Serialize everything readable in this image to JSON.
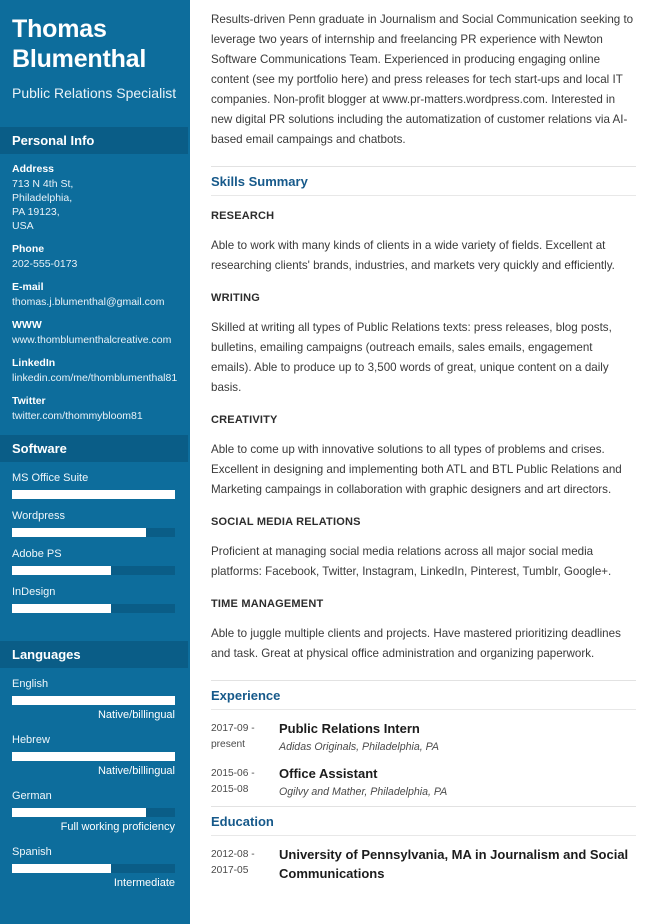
{
  "sidebar": {
    "name": "Thomas Blumenthal",
    "job_title": "Public Relations Specialist",
    "accent_color": "#0d6d9c",
    "header_band_color": "#0a5d87",
    "personal_info": {
      "heading": "Personal Info",
      "items": [
        {
          "label": "Address",
          "value": "713 N 4th St,\nPhiladelphia,\nPA 19123,\nUSA"
        },
        {
          "label": "Phone",
          "value": "202-555-0173"
        },
        {
          "label": "E-mail",
          "value": "thomas.j.blumenthal@gmail.com"
        },
        {
          "label": "WWW",
          "value": "www.thomblumenthalcreative.com"
        },
        {
          "label": "LinkedIn",
          "value": "linkedin.com/me/thomblumenthal81"
        },
        {
          "label": "Twitter",
          "value": "twitter.com/thommybloom81"
        }
      ]
    },
    "software": {
      "heading": "Software",
      "items": [
        {
          "label": "MS Office Suite",
          "percent": 100
        },
        {
          "label": "Wordpress",
          "percent": 82
        },
        {
          "label": "Adobe PS",
          "percent": 61
        },
        {
          "label": "InDesign",
          "percent": 61
        }
      ]
    },
    "languages": {
      "heading": "Languages",
      "items": [
        {
          "label": "English",
          "percent": 100,
          "level": "Native/billingual"
        },
        {
          "label": "Hebrew",
          "percent": 100,
          "level": "Native/billingual"
        },
        {
          "label": "German",
          "percent": 82,
          "level": "Full working proficiency"
        },
        {
          "label": "Spanish",
          "percent": 61,
          "level": "Intermediate"
        }
      ]
    }
  },
  "main": {
    "summary": "Results-driven Penn graduate in Journalism and Social Communication seeking to leverage two years of internship and freelancing PR experience with Newton Software Communications Team. Experienced in producing engaging online content (see my portfolio here) and press releases for tech start-ups and local IT companies. Non-profit blogger at www.pr-matters.wordpress.com. Interested in new digital PR solutions including the automatization of customer relations via AI-based email campaings and chatbots.",
    "skills_summary": {
      "heading": "Skills Summary",
      "skills": [
        {
          "name": "RESEARCH",
          "description": "Able to work with many kinds of clients in a wide variety of fields. Excellent at researching clients' brands, industries, and markets very quickly and efficiently."
        },
        {
          "name": "WRITING",
          "description": "Skilled at writing all types of Public Relations texts: press releases, blog posts, bulletins, emailing campaigns (outreach emails, sales emails, engagement emails). Able to produce up to 3,500 words of great, unique content on a daily basis."
        },
        {
          "name": "CREATIVITY",
          "description": "Able to come up with innovative solutions to all types of problems and crises. Excellent in designing and implementing both ATL and BTL Public Relations and Marketing campaings in collaboration with graphic designers and art directors."
        },
        {
          "name": "SOCIAL MEDIA RELATIONS",
          "description": "Proficient at managing social media relations across all major social media platforms: Facebook, Twitter, Instagram, LinkedIn, Pinterest, Tumblr, Google+."
        },
        {
          "name": "TIME MANAGEMENT",
          "description": "Able to juggle multiple clients and projects. Have mastered prioritizing deadlines and task. Great at physical office administration and organizing paperwork."
        }
      ]
    },
    "experience": {
      "heading": "Experience",
      "entries": [
        {
          "date": "2017-09 - present",
          "role": "Public Relations Intern",
          "org": "Adidas Originals, Philadelphia, PA"
        },
        {
          "date": "2015-06 - 2015-08",
          "role": "Office Assistant",
          "org": "Ogilvy and Mather, Philadelphia, PA"
        }
      ]
    },
    "education": {
      "heading": "Education",
      "entries": [
        {
          "date": "2012-08 - 2017-05",
          "role": "University of Pennsylvania, MA in Journalism and Social Communications",
          "org": ""
        }
      ]
    }
  }
}
